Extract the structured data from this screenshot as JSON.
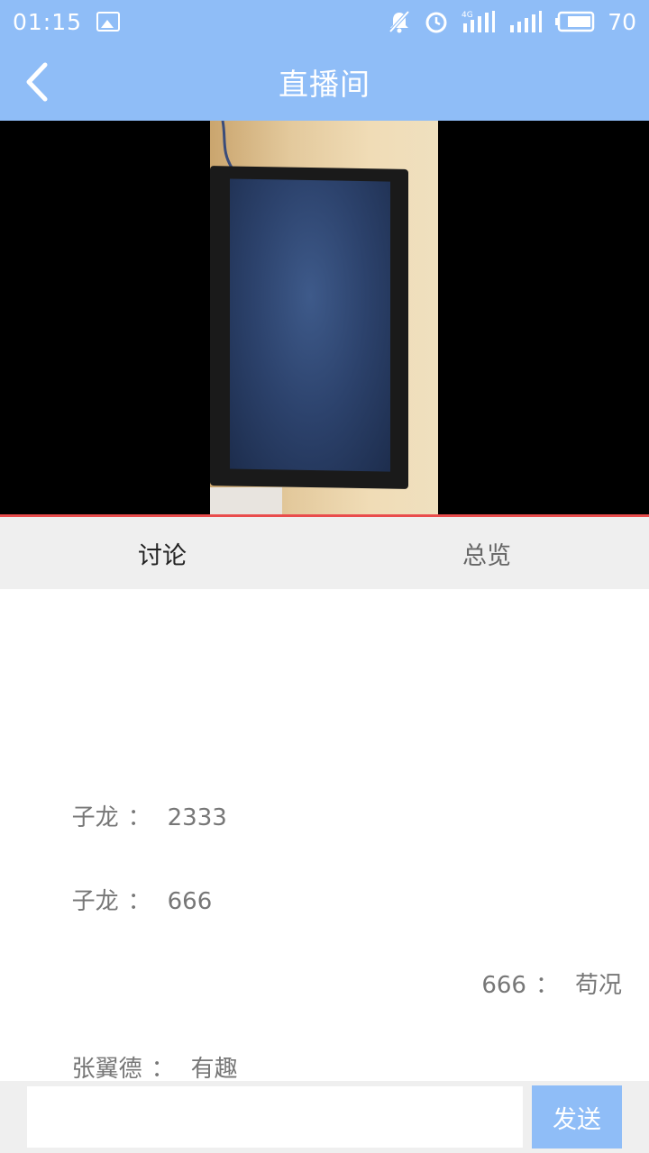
{
  "status_bar": {
    "time": "01:15",
    "network_label": "4G",
    "battery_level": "70",
    "icons": [
      "image-icon",
      "bell-muted-icon",
      "alarm-icon",
      "signal-4g-icon",
      "signal-icon",
      "battery-icon"
    ]
  },
  "header": {
    "title": "直播间",
    "back_icon": "chevron-left-icon"
  },
  "tabs": [
    {
      "label": "讨论",
      "active": true
    },
    {
      "label": "总览",
      "active": false
    }
  ],
  "messages": [
    {
      "user": "子龙",
      "separator": "：",
      "text": "2333",
      "align": "left"
    },
    {
      "user": "子龙",
      "separator": "：",
      "text": "666",
      "align": "left"
    },
    {
      "user": "666",
      "separator": "：",
      "text": "苟况",
      "align": "right"
    },
    {
      "user": "张翼德",
      "separator": "：",
      "text": "有趣",
      "align": "left"
    }
  ],
  "input": {
    "value": "",
    "placeholder": "",
    "send_label": "发送"
  },
  "colors": {
    "header_bg": "#8fbdf7",
    "tab_bar_bg": "#efefef",
    "divider_accent": "#e94c4c",
    "send_button_bg": "#8fbdf7"
  }
}
